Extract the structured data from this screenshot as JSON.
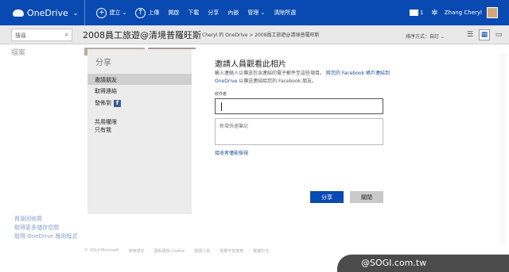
{
  "app": {
    "name": "OneDrive"
  },
  "commands": [
    {
      "icon": "plus-circle-icon",
      "label": "建立",
      "chevron": "⌄"
    },
    {
      "icon": "upload-icon",
      "label": "上傳"
    },
    {
      "label": "開啟"
    },
    {
      "label": "下載"
    },
    {
      "label": "分享"
    },
    {
      "label": "內嵌"
    },
    {
      "label": "管理",
      "chevron": "⌄"
    },
    {
      "label": "清除所選"
    }
  ],
  "user": {
    "name": "Zhang Cheryl",
    "notifications": "1"
  },
  "search": {
    "placeholder": "搜尋"
  },
  "album": {
    "title": "2008員工旅遊@清境普羅旺斯",
    "breadcrumb": "Cheryl 的 OneDrive > 2008員工旅遊@清境普羅旺斯"
  },
  "sort": {
    "label": "排序方式：自訂 ⌄"
  },
  "background": {
    "nav_label": "檔案",
    "left_links": [
      "資源回收筒",
      "取得更多儲存空間",
      "取得 OneDrive 應用程式"
    ],
    "footer": [
      "© 2014 Microsoft",
      "使用規定",
      "隱私權與 Cookie",
      "開發人員",
      "檢舉不當使用",
      "繁體中文"
    ]
  },
  "dialog": {
    "title": "分享",
    "options": [
      {
        "label": "邀請朋友",
        "selected": true
      },
      {
        "label": "取得連結",
        "selected": false
      },
      {
        "label": "發佈到",
        "selected": false
      }
    ],
    "permission_label": "共用權限",
    "permission_value": "只有我",
    "heading": "邀請人員觀看此相片",
    "desc_text": "輸入連絡人以傳送包含連結的電子郵件至這些項目。",
    "desc_link1": "將您的 Facebook 帳戶連結到 OneDrive",
    "desc_text2": "以傳送連結給您的 Facebook 朋友。",
    "to_label": "收件者",
    "note_placeholder": "新增快速筆記",
    "recipient_link": "接收者僅能檢視",
    "share_button": "分享",
    "close_button": "關閉"
  },
  "watermark": "@SOGI.com.tw",
  "colors": {
    "brand": "#094ab2",
    "facebook": "#3b5998"
  }
}
